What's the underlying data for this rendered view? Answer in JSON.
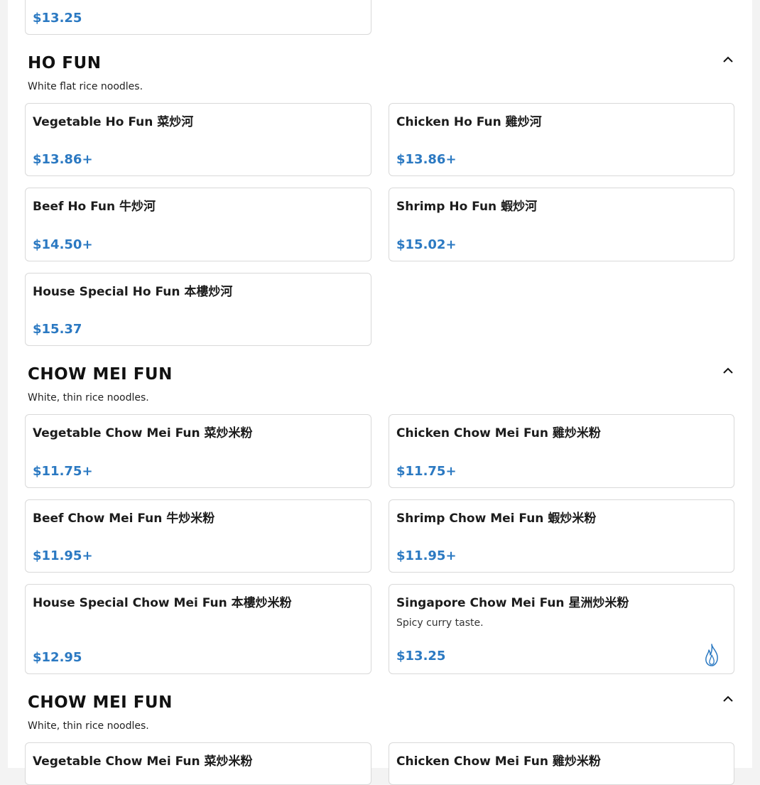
{
  "top_card": {
    "price": "$13.25"
  },
  "sections": [
    {
      "title": "HO FUN",
      "description": "White flat rice noodles.",
      "items": [
        {
          "name": "Vegetable Ho Fun 菜炒河",
          "price": "$13.86+"
        },
        {
          "name": "Chicken Ho Fun 雞炒河",
          "price": "$13.86+"
        },
        {
          "name": "Beef Ho Fun 牛炒河",
          "price": "$14.50+"
        },
        {
          "name": "Shrimp Ho Fun 蝦炒河",
          "price": "$15.02+"
        },
        {
          "name": "House Special Ho Fun 本樓炒河",
          "price": "$15.37"
        }
      ]
    },
    {
      "title": "CHOW MEI FUN",
      "description": "White, thin rice noodles.",
      "items": [
        {
          "name": "Vegetable Chow Mei Fun 菜炒米粉",
          "price": "$11.75+"
        },
        {
          "name": "Chicken Chow Mei Fun 雞炒米粉",
          "price": "$11.75+"
        },
        {
          "name": "Beef Chow Mei Fun 牛炒米粉",
          "price": "$11.95+"
        },
        {
          "name": "Shrimp Chow Mei Fun 蝦炒米粉",
          "price": "$11.95+"
        },
        {
          "name": "House Special Chow Mei Fun 本樓炒米粉",
          "price": "$12.95"
        },
        {
          "name": "Singapore Chow Mei Fun 星洲炒米粉",
          "description": "Spicy curry taste.",
          "price": "$13.25",
          "icon": "flame-icon"
        }
      ]
    },
    {
      "title": "CHOW MEI FUN",
      "description": "White, thin rice noodles.",
      "items": [
        {
          "name": "Vegetable Chow Mei Fun 菜炒米粉"
        },
        {
          "name": "Chicken Chow Mei Fun 雞炒米粉"
        }
      ]
    }
  ],
  "colors": {
    "price": "#2b79c2",
    "border": "#d9d9d9",
    "spicy_icon": "#2b79c2"
  },
  "icons": {
    "section_toggle": "chevron-up-icon",
    "spicy": "flame-icon"
  }
}
